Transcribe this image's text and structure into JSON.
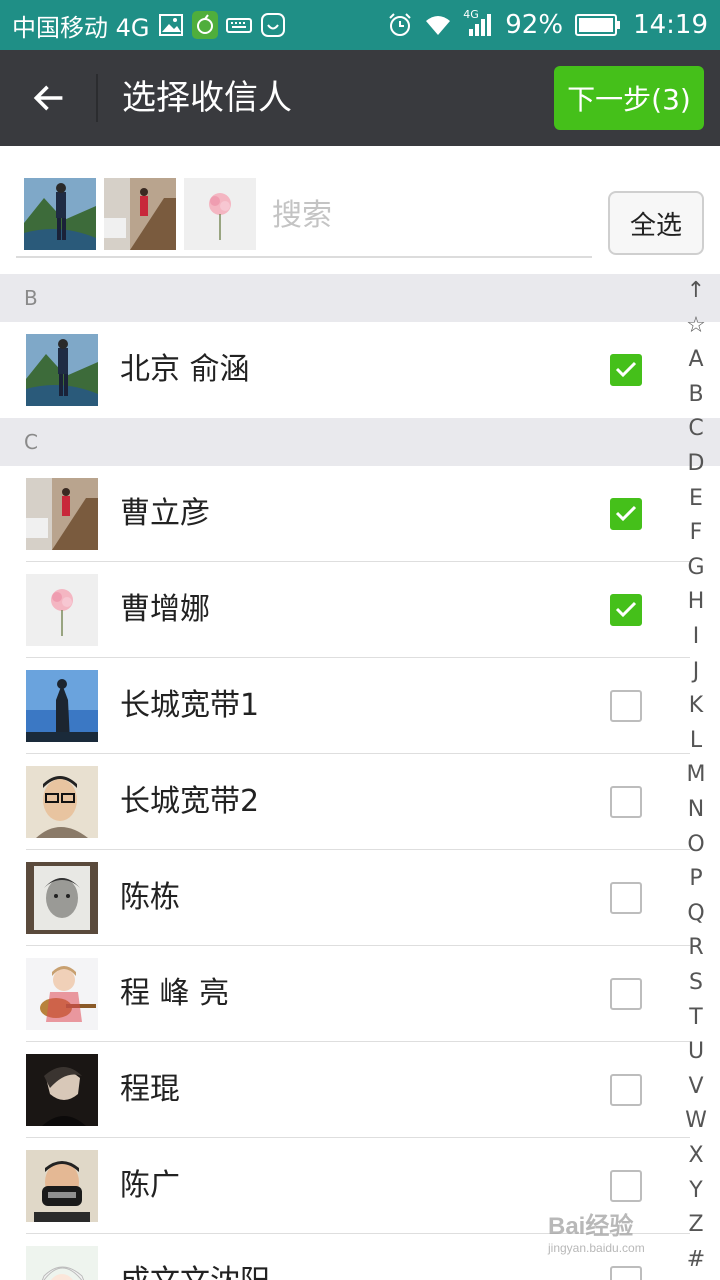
{
  "status_bar": {
    "carrier": "中国移动 4G",
    "network": "4G",
    "battery": "92%",
    "time": "14:19"
  },
  "title_bar": {
    "title": "选择收信人",
    "next_button": "下一步(3)"
  },
  "search": {
    "placeholder": "搜索",
    "select_all": "全选"
  },
  "sections": [
    {
      "letter": "B",
      "contacts": [
        {
          "name": "北京 俞涵",
          "checked": true
        }
      ]
    },
    {
      "letter": "C",
      "contacts": [
        {
          "name": "曹立彦",
          "checked": true
        },
        {
          "name": "曹增娜",
          "checked": true
        },
        {
          "name": "长城宽带1",
          "checked": false
        },
        {
          "name": "长城宽带2",
          "checked": false
        },
        {
          "name": "陈栋",
          "checked": false
        },
        {
          "name": "程 峰 亮",
          "checked": false
        },
        {
          "name": "程琨",
          "checked": false
        },
        {
          "name": "陈广",
          "checked": false
        },
        {
          "name": "成文文沈阳",
          "checked": false
        }
      ]
    }
  ],
  "index_bar": [
    "↑",
    "☆",
    "A",
    "B",
    "C",
    "D",
    "E",
    "F",
    "G",
    "H",
    "I",
    "J",
    "K",
    "L",
    "M",
    "N",
    "O",
    "P",
    "Q",
    "R",
    "S",
    "T",
    "U",
    "V",
    "W",
    "X",
    "Y",
    "Z",
    "#"
  ],
  "watermark": {
    "main": "Bai经验",
    "sub": "jingyan.baidu.com"
  },
  "colors": {
    "status_bar": "#1f8f86",
    "title_bar": "#393a3e",
    "accent_green": "#45c01a",
    "section_bg": "#e9e9ed"
  }
}
